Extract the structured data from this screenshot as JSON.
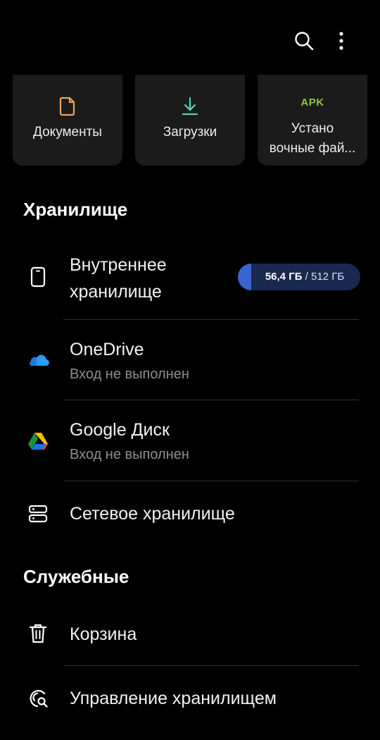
{
  "header": {
    "icons": [
      "search-icon",
      "more-vert-icon"
    ]
  },
  "quick_tiles": [
    {
      "label": "Документы",
      "icon": "document-icon",
      "icon_color": "#e8a45a"
    },
    {
      "label": "Загрузки",
      "icon": "download-icon",
      "icon_color": "#5bd1b8"
    },
    {
      "label_line1": "Устано",
      "label_line2": "вочные фай...",
      "icon_text": "APK",
      "icon_color": "#8ec43c"
    }
  ],
  "storage_section": {
    "title": "Хранилище",
    "items": [
      {
        "title_line1": "Внутреннее",
        "title_line2": "хранилище",
        "icon": "phone-icon",
        "used": "56,4 ГБ",
        "separator": " / ",
        "total": "512 ГБ",
        "used_fraction": 0.11,
        "pill_color": "#18284e",
        "fill_color": "#3a63d1"
      },
      {
        "title": "OneDrive",
        "subtitle": "Вход не выполнен",
        "icon": "onedrive-icon"
      },
      {
        "title": "Google Диск",
        "subtitle": "Вход не выполнен",
        "icon": "google-drive-icon"
      },
      {
        "title": "Сетевое хранилище",
        "icon": "network-storage-icon"
      }
    ]
  },
  "utilities_section": {
    "title": "Служебные",
    "items": [
      {
        "title": "Корзина",
        "icon": "trash-icon"
      },
      {
        "title": "Управление хранилищем",
        "icon": "storage-manage-icon"
      }
    ]
  },
  "colors": {
    "background": "#000000",
    "tile_bg": "#1b1b1b",
    "subtitle": "#8e8e8e",
    "divider": "#333333"
  }
}
